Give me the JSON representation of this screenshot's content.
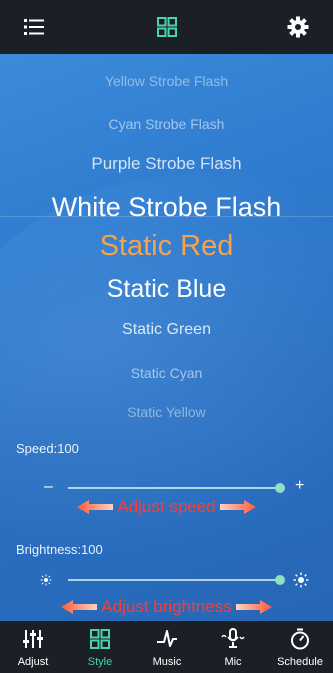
{
  "topbar": {
    "menu_icon": "list-menu-icon",
    "center_icon": "grid-icon",
    "settings_icon": "gear-icon"
  },
  "modes": [
    "Yellow Strobe Flash",
    "Cyan Strobe Flash",
    "Purple Strobe Flash",
    "White Strobe Flash",
    "Static Red",
    "Static Blue",
    "Static Green",
    "Static Cyan",
    "Static Yellow"
  ],
  "selected_mode": "Static Red",
  "speed": {
    "label": "Speed:100",
    "value": 100,
    "max": 100,
    "minus": "–",
    "plus": "+",
    "annotation": "Adjust speed"
  },
  "brightness": {
    "label": "Brightness:100",
    "value": 100,
    "max": 100,
    "annotation": "Adjust brightness"
  },
  "nav": [
    {
      "label": "Adjust",
      "icon": "sliders-icon",
      "active": false
    },
    {
      "label": "Style",
      "icon": "grid-icon",
      "active": true
    },
    {
      "label": "Music",
      "icon": "music-note-icon",
      "active": false
    },
    {
      "label": "Mic",
      "icon": "microphone-icon",
      "active": false
    },
    {
      "label": "Schedule",
      "icon": "timer-icon",
      "active": false
    }
  ],
  "colors": {
    "accent": "#49d3b0",
    "selected_text": "#f7a24a",
    "annotation": "#ff3b2f",
    "bar": "#1b1f26",
    "main_blue": "#2f7cd0"
  }
}
